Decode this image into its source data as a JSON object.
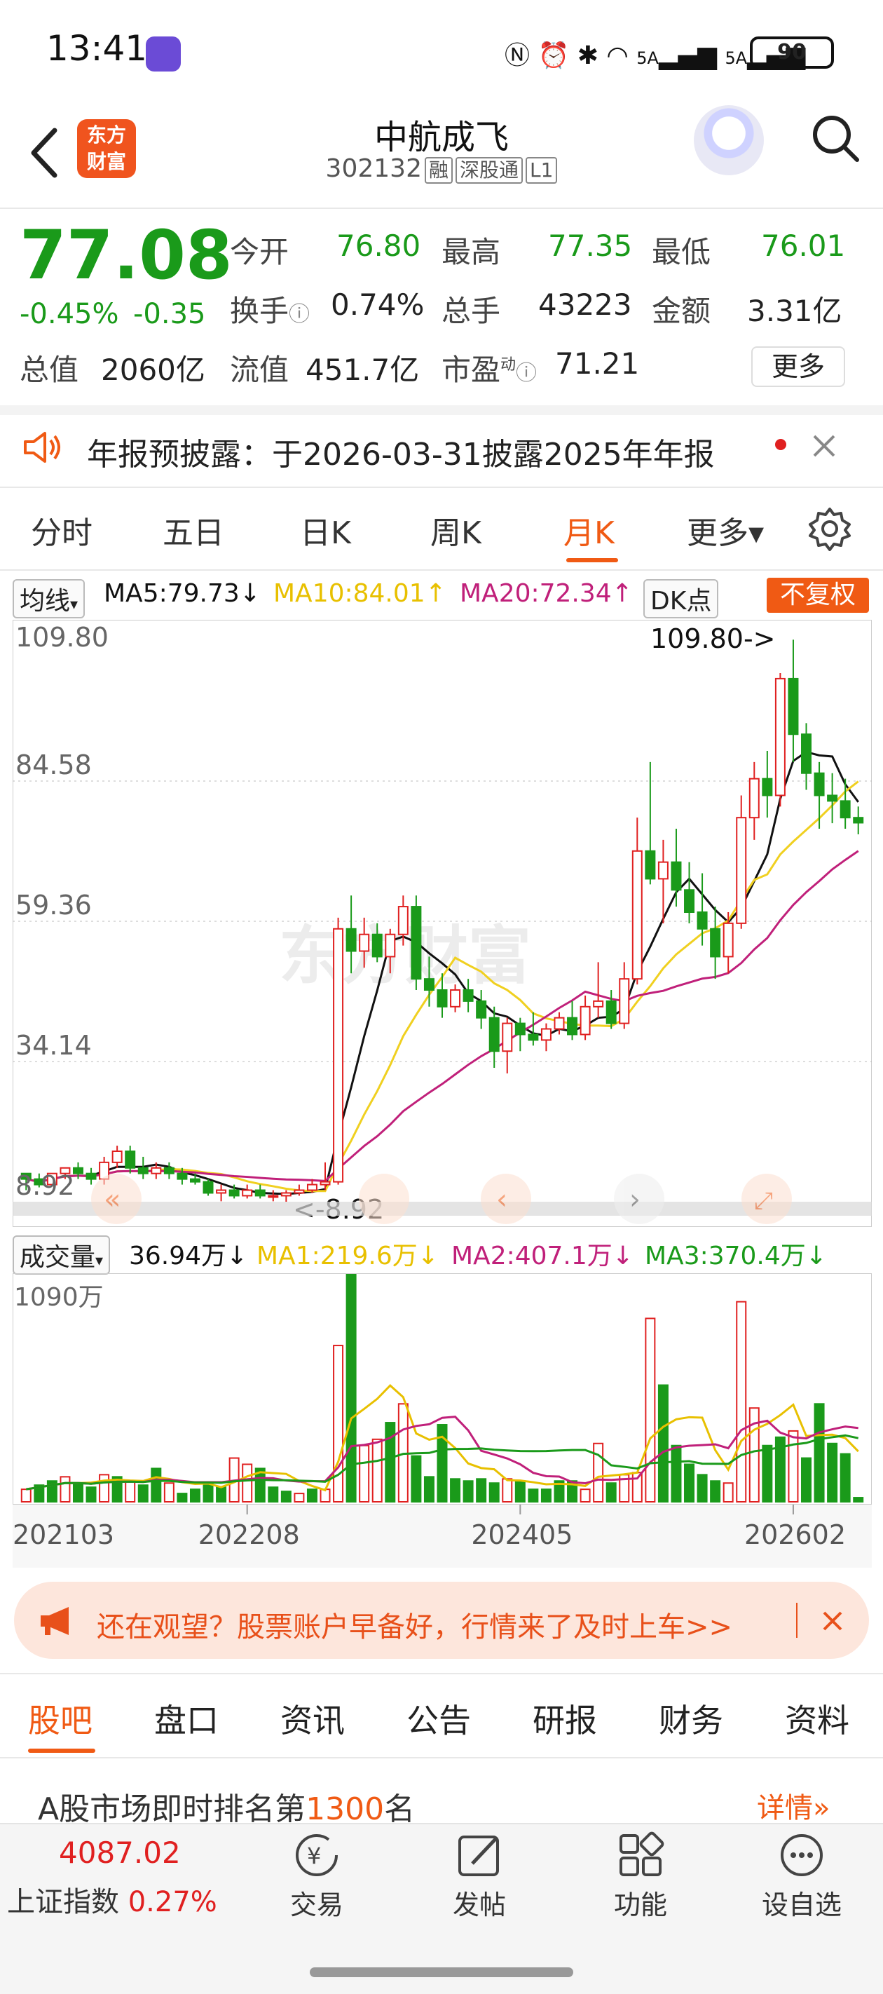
{
  "status_bar": {
    "time": "13:41",
    "network1": "5A",
    "network2": "5A",
    "battery": "90"
  },
  "header": {
    "logo_line1": "东方",
    "logo_line2": "财富",
    "stock_name": "中航成飞",
    "stock_code": "302132",
    "tags": [
      "融",
      "深股通",
      "L1"
    ]
  },
  "quote": {
    "price": "77.08",
    "change_pct": "-0.45%",
    "change_amt": "-0.35",
    "fields": [
      {
        "label": "今开",
        "value": "76.80",
        "color": "#1a9a1a"
      },
      {
        "label": "最高",
        "value": "77.35",
        "color": "#1a9a1a"
      },
      {
        "label": "最低",
        "value": "76.01",
        "color": "#1a9a1a"
      },
      {
        "label": "换手",
        "value": "0.74%",
        "color": "#222222"
      },
      {
        "label": "总手",
        "value": "43223",
        "color": "#222222"
      },
      {
        "label": "金额",
        "value": "3.31亿",
        "color": "#222222"
      },
      {
        "label": "总值",
        "value": "2060亿",
        "color": "#222222"
      },
      {
        "label": "流值",
        "value": "451.7亿",
        "color": "#222222"
      },
      {
        "label": "市盈",
        "value": "71.21",
        "color": "#222222"
      }
    ],
    "pe_sup": "动",
    "more": "更多"
  },
  "notice": {
    "text": "年报预披露：于2026-03-31披露2025年年报"
  },
  "period_tabs": [
    "分时",
    "五日",
    "日K",
    "周K",
    "月K",
    "更多▾"
  ],
  "active_period": "月K",
  "indicators": {
    "ma_selector": "均线",
    "ma5": "MA5:79.73",
    "ma10": "MA10:84.01",
    "ma20": "MA20:72.34",
    "dk": "DK点",
    "adjust": "不复权",
    "vol_selector": "成交量",
    "vol": "36.94万",
    "vma1": "MA1:219.6万",
    "vma2": "MA2:407.1万",
    "vma3": "MA3:370.4万",
    "arrow_down": "↓",
    "arrow_up": "↑"
  },
  "colors": {
    "up": "#e02020",
    "down": "#1a9a1a",
    "ma5": "#111111",
    "ma10": "#f0d020",
    "ma20": "#c0207a",
    "accent": "#f05a14"
  },
  "chart_data": {
    "type": "candlestick",
    "y_axis_ticks": [
      "109.80",
      "84.58",
      "59.36",
      "34.14",
      "8.92"
    ],
    "ylim": [
      8.92,
      109.8
    ],
    "annotations": {
      "max": "109.80->",
      "min": "<-8.92"
    },
    "x_tick_labels": [
      "202103",
      "202208",
      "202405",
      "202602"
    ],
    "watermark": "东方财富",
    "candles": [
      [
        14,
        14,
        11,
        13
      ],
      [
        13,
        14,
        11.5,
        12
      ],
      [
        12,
        14,
        12,
        14
      ],
      [
        14,
        15,
        13,
        15
      ],
      [
        15,
        16,
        13,
        14
      ],
      [
        14,
        15,
        12,
        13
      ],
      [
        13,
        17,
        12,
        16
      ],
      [
        16,
        19,
        15,
        18
      ],
      [
        18,
        19,
        14,
        15
      ],
      [
        15,
        17,
        13,
        14
      ],
      [
        14,
        16,
        13,
        15
      ],
      [
        15,
        16,
        13,
        14
      ],
      [
        14,
        15,
        12,
        13
      ],
      [
        13,
        14,
        12,
        12.5
      ],
      [
        12.5,
        13,
        10,
        10.5
      ],
      [
        10.5,
        12,
        9,
        11
      ],
      [
        11,
        12,
        9.5,
        10
      ],
      [
        10,
        12,
        9.5,
        11
      ],
      [
        11,
        12,
        9.5,
        10
      ],
      [
        10,
        11,
        9,
        10
      ],
      [
        10,
        11,
        8.92,
        10.5
      ],
      [
        10.5,
        12,
        10,
        11
      ],
      [
        11,
        13,
        10.5,
        12
      ],
      [
        12,
        16,
        11,
        12.5
      ],
      [
        12.5,
        60,
        12,
        58
      ],
      [
        58,
        64,
        50,
        54
      ],
      [
        54,
        60,
        51,
        57
      ],
      [
        57,
        59,
        52,
        53
      ],
      [
        53,
        58,
        50,
        57
      ],
      [
        57,
        64,
        55,
        62
      ],
      [
        62,
        64,
        47,
        49
      ],
      [
        49,
        53,
        44,
        47
      ],
      [
        47,
        50,
        42,
        44
      ],
      [
        44,
        48,
        43,
        47
      ],
      [
        47,
        49,
        43,
        45
      ],
      [
        45,
        47,
        40,
        42
      ],
      [
        42,
        44,
        33,
        36
      ],
      [
        36,
        42,
        32,
        41
      ],
      [
        41,
        42,
        36,
        39
      ],
      [
        39,
        43,
        37,
        38
      ],
      [
        38,
        41,
        36,
        40
      ],
      [
        40,
        43,
        39,
        42
      ],
      [
        42,
        45,
        38,
        39
      ],
      [
        39,
        46,
        38,
        44
      ],
      [
        44,
        52,
        42,
        45
      ],
      [
        45,
        47,
        40,
        41
      ],
      [
        41,
        52,
        40,
        49
      ],
      [
        49,
        78,
        48,
        72
      ],
      [
        72,
        88,
        66,
        67
      ],
      [
        67,
        74,
        59,
        70
      ],
      [
        70,
        76,
        62,
        65
      ],
      [
        65,
        70,
        59,
        61
      ],
      [
        61,
        68,
        55,
        58
      ],
      [
        58,
        62,
        49,
        53
      ],
      [
        53,
        61,
        50,
        59
      ],
      [
        59,
        82,
        58,
        78
      ],
      [
        78,
        88,
        74,
        85
      ],
      [
        85,
        90,
        78,
        82
      ],
      [
        82,
        104,
        80,
        103
      ],
      [
        103,
        110,
        88,
        93
      ],
      [
        93,
        95,
        83,
        86
      ],
      [
        86,
        88,
        76,
        82
      ],
      [
        82,
        86,
        77,
        81
      ],
      [
        81,
        85,
        76,
        78
      ],
      [
        78,
        80,
        75,
        77.08
      ]
    ],
    "volume": {
      "max_label": "1090万",
      "ylim": [
        0,
        1090
      ],
      "bars": [
        [
          60,
          1
        ],
        [
          80,
          0
        ],
        [
          100,
          0
        ],
        [
          120,
          1
        ],
        [
          90,
          0
        ],
        [
          70,
          0
        ],
        [
          130,
          1
        ],
        [
          120,
          0
        ],
        [
          100,
          1
        ],
        [
          80,
          0
        ],
        [
          160,
          0
        ],
        [
          90,
          1
        ],
        [
          40,
          0
        ],
        [
          60,
          0
        ],
        [
          90,
          0
        ],
        [
          70,
          0
        ],
        [
          210,
          1
        ],
        [
          180,
          1
        ],
        [
          160,
          0
        ],
        [
          70,
          0
        ],
        [
          50,
          0
        ],
        [
          40,
          1
        ],
        [
          60,
          0
        ],
        [
          60,
          1
        ],
        [
          750,
          1
        ],
        [
          1090,
          0
        ],
        [
          270,
          1
        ],
        [
          300,
          1
        ],
        [
          380,
          0
        ],
        [
          470,
          1
        ],
        [
          220,
          0
        ],
        [
          120,
          0
        ],
        [
          370,
          0
        ],
        [
          110,
          0
        ],
        [
          100,
          0
        ],
        [
          110,
          0
        ],
        [
          90,
          0
        ],
        [
          110,
          1
        ],
        [
          100,
          0
        ],
        [
          60,
          0
        ],
        [
          60,
          0
        ],
        [
          100,
          0
        ],
        [
          100,
          0
        ],
        [
          60,
          1
        ],
        [
          280,
          1
        ],
        [
          90,
          0
        ],
        [
          130,
          1
        ],
        [
          140,
          1
        ],
        [
          880,
          1
        ],
        [
          560,
          0
        ],
        [
          270,
          0
        ],
        [
          180,
          0
        ],
        [
          130,
          0
        ],
        [
          100,
          0
        ],
        [
          90,
          1
        ],
        [
          960,
          1
        ],
        [
          450,
          1
        ],
        [
          270,
          0
        ],
        [
          310,
          0
        ],
        [
          340,
          1
        ],
        [
          210,
          0
        ],
        [
          470,
          0
        ],
        [
          280,
          0
        ],
        [
          230,
          0
        ],
        [
          20,
          0
        ]
      ]
    }
  },
  "banner": {
    "text": "还在观望？股票账户早备好，行情来了及时上车>>"
  },
  "content_tabs": [
    "股吧",
    "盘口",
    "资讯",
    "公告",
    "研报",
    "财务",
    "资料"
  ],
  "active_content_tab": "股吧",
  "ranking": {
    "prefix": "A股市场即时排名第",
    "rank": "1300",
    "suffix": "名",
    "detail": "详情"
  },
  "bottom_nav": {
    "index_value": "4087.02",
    "index_name": "上证指数",
    "index_change": "0.27%",
    "items": [
      {
        "label": "交易",
        "icon": "trade-icon"
      },
      {
        "label": "发帖",
        "icon": "post-icon"
      },
      {
        "label": "功能",
        "icon": "apps-icon"
      },
      {
        "label": "设自选",
        "icon": "favorite-icon"
      }
    ]
  }
}
